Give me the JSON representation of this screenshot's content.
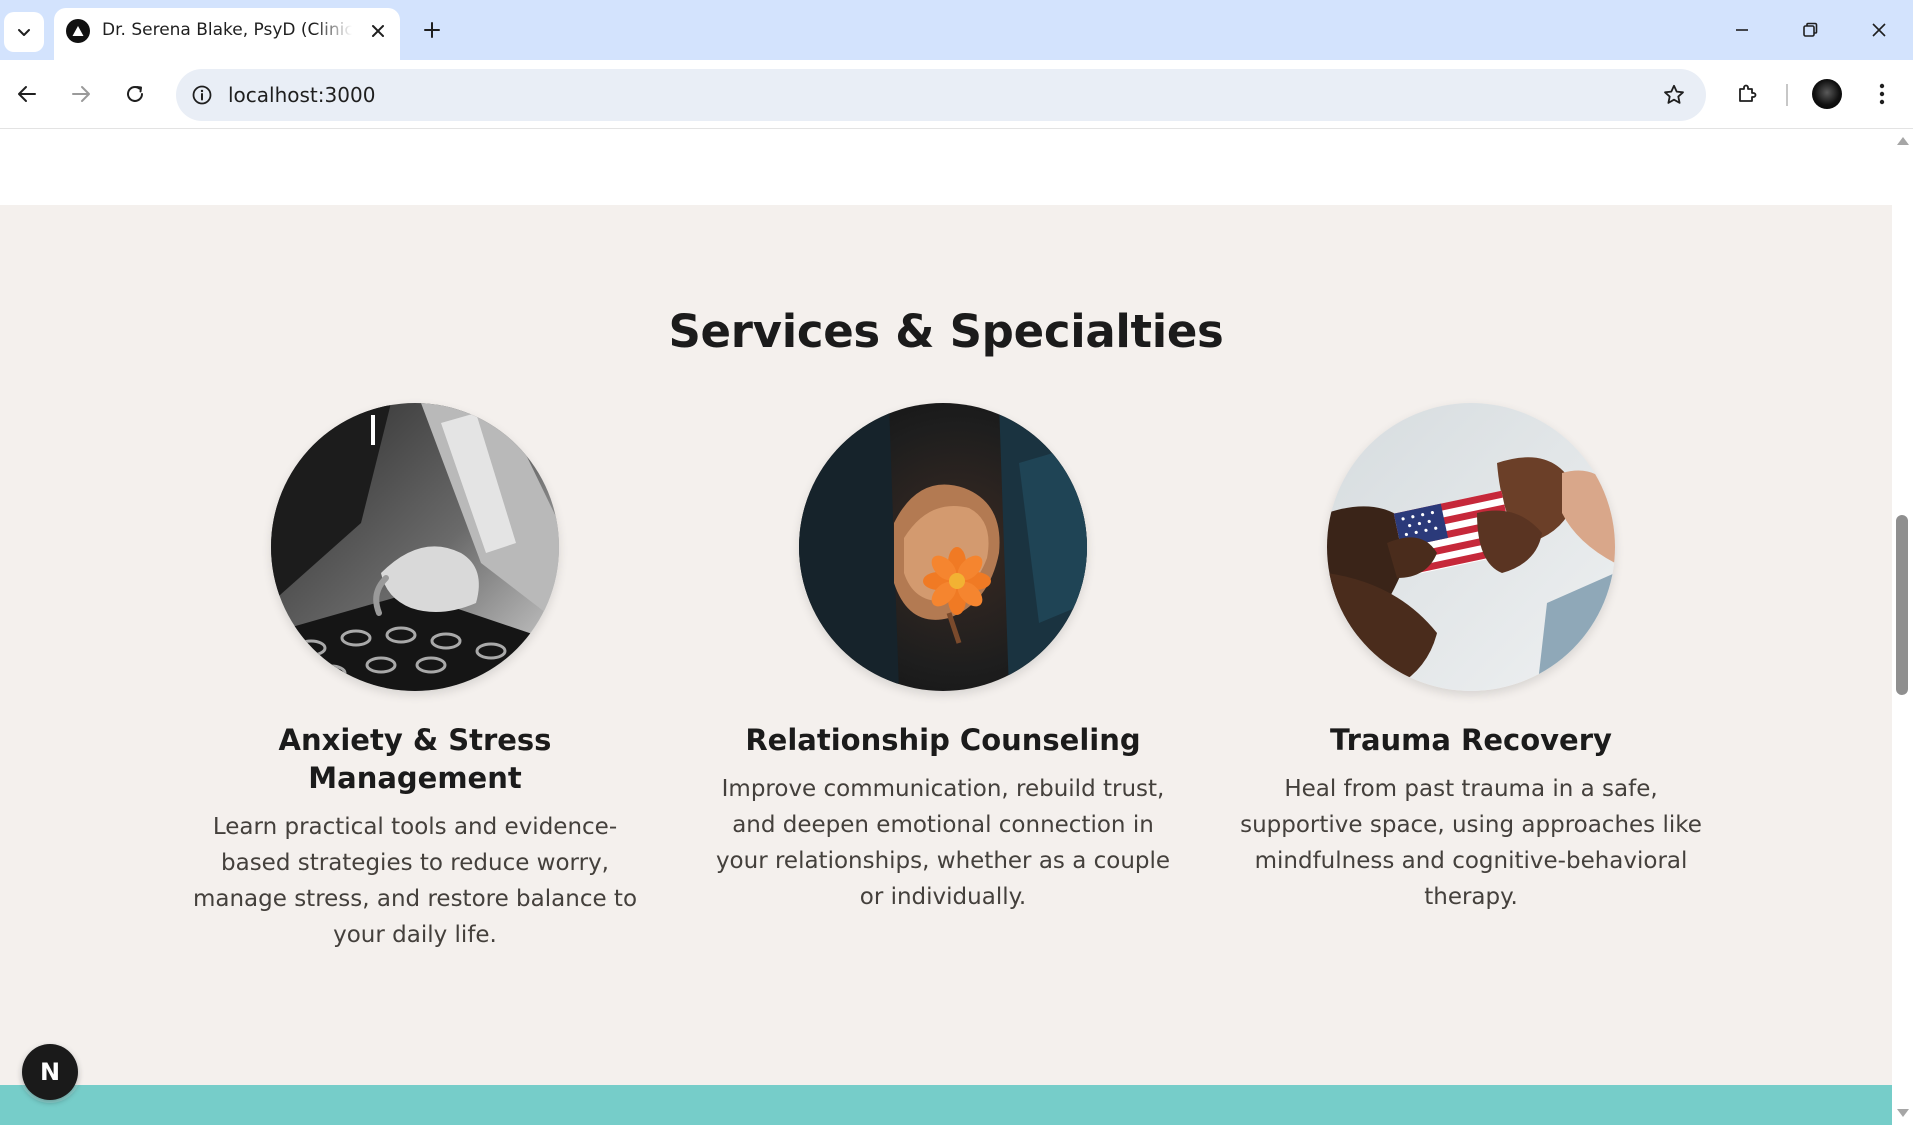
{
  "browser": {
    "tab_title": "Dr. Serena Blake, PsyD (Clinical Psychologist)",
    "url": "localhost:3000"
  },
  "services": {
    "heading": "Services & Specialties",
    "cards": [
      {
        "title": "Anxiety & Stress Management",
        "description": "Learn practical tools and evidence-based strategies to reduce worry, manage stress, and restore balance to your daily life.",
        "image": "grayscale-hands-photo"
      },
      {
        "title": "Relationship Counseling",
        "description": "Improve communication, rebuild trust, and deepen emotional connection in your relationships, whether as a couple or individually.",
        "image": "hands-holding-orange-flower-photo"
      },
      {
        "title": "Trauma Recovery",
        "description": "Heal from past trauma in a safe, supportive space, using approaches like mindfulness and cognitive-behavioral therapy.",
        "image": "hands-holding-american-flag-photo"
      }
    ]
  },
  "dev_badge": {
    "label": "N"
  },
  "colors": {
    "section_bg": "#f4f0ed",
    "divider": "#b8a394",
    "teal_band": "#76cdc9",
    "chrome_tabbar": "#d3e3fd"
  }
}
